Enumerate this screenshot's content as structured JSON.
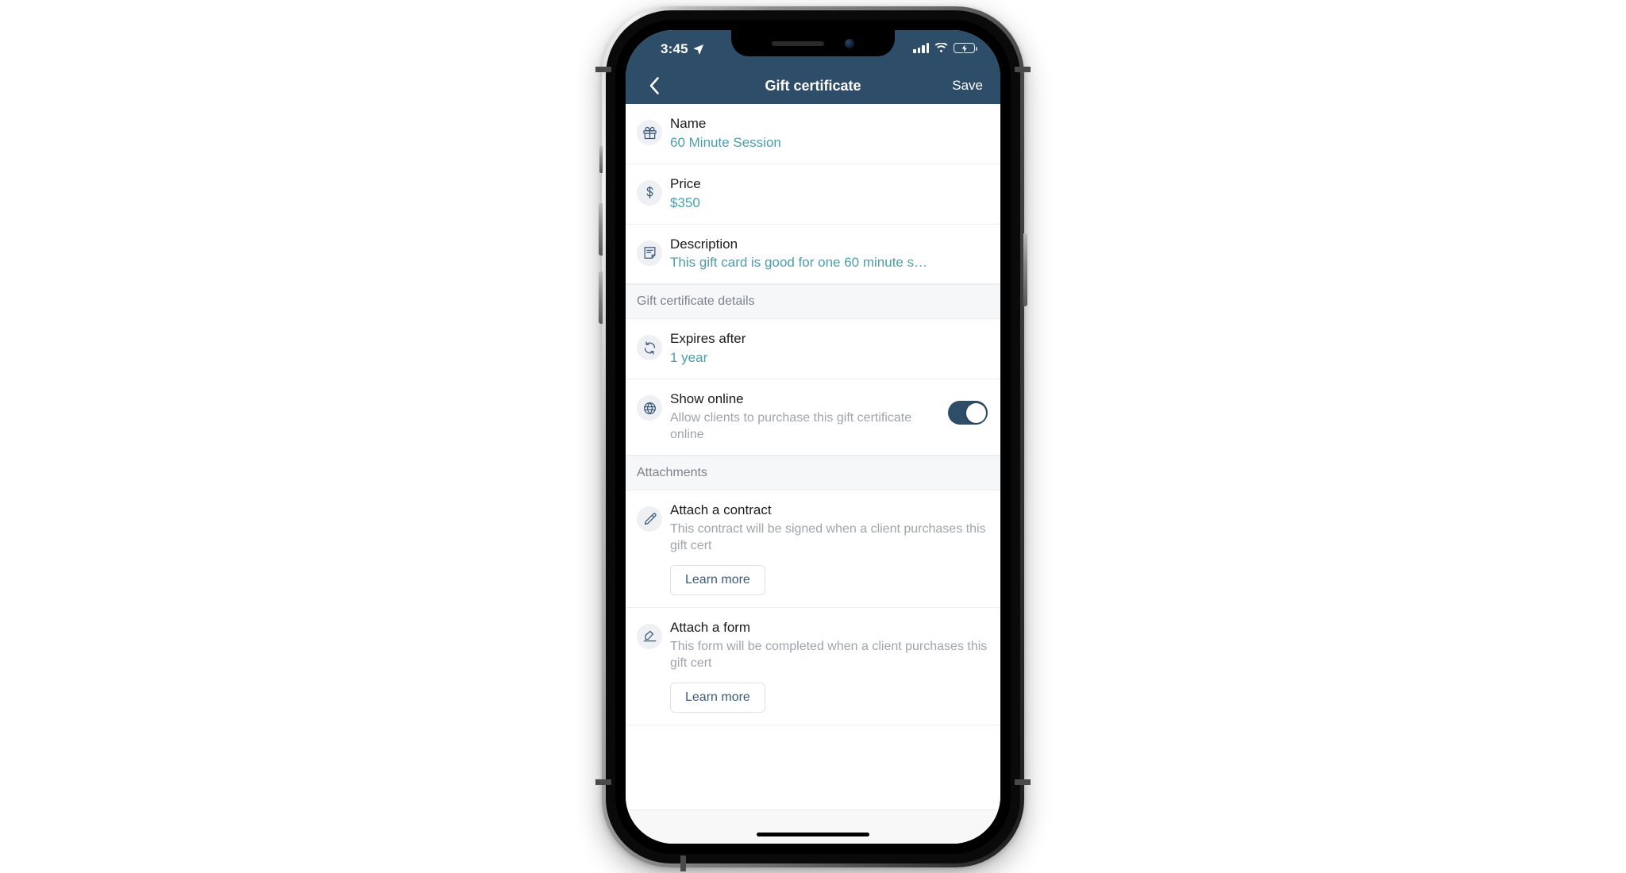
{
  "status_bar": {
    "time": "3:45",
    "location_icon": "location-arrow-icon",
    "signal_icon": "cellular-signal-icon",
    "wifi_icon": "wifi-icon",
    "battery_icon": "battery-charging-icon"
  },
  "nav": {
    "back_icon": "chevron-left-icon",
    "title": "Gift certificate",
    "save_label": "Save"
  },
  "colors": {
    "nav_bar": "#2e4d68",
    "value_teal": "#4a9eae",
    "toggle_on": "#2e4d68",
    "section_bg": "#f6f7f8",
    "subtext_gray": "#a0a4aa",
    "button_text": "#3b5a79",
    "battery_green": "#32d74b"
  },
  "rows": [
    {
      "icon": "gift-icon",
      "label": "Name",
      "value": "60 Minute Session"
    },
    {
      "icon": "dollar-sign-icon",
      "label": "Price",
      "value": "$350"
    },
    {
      "icon": "note-document-icon",
      "label": "Description",
      "value": "This gift card is good for one 60 minute s…"
    }
  ],
  "sections": [
    {
      "header": "Gift certificate details",
      "rows": [
        {
          "icon": "refresh-cycle-icon",
          "label": "Expires after",
          "value": "1 year"
        },
        {
          "icon": "globe-icon",
          "label": "Show online",
          "sub": "Allow clients to purchase this gift certificate online",
          "toggle": true,
          "toggle_on": true
        }
      ]
    },
    {
      "header": "Attachments",
      "rows": [
        {
          "icon": "pen-signature-icon",
          "label": "Attach a contract",
          "sub": "This contract will be signed when a client purchases this gift cert",
          "button": "Learn more"
        },
        {
          "icon": "form-edit-icon",
          "label": "Attach a form",
          "sub": "This form will be completed when a client purchases this gift cert",
          "button": "Learn more"
        }
      ]
    }
  ],
  "home_indicator": "home-indicator-bar"
}
